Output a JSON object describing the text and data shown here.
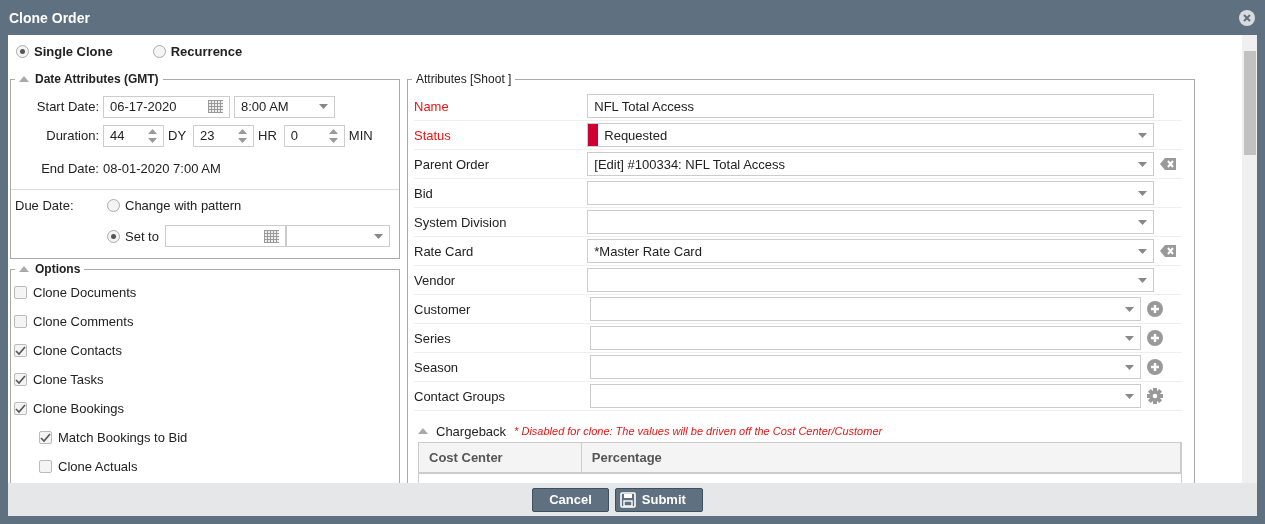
{
  "window": {
    "title": "Clone Order"
  },
  "mode_options": [
    {
      "label": "Single Clone",
      "selected": true
    },
    {
      "label": "Recurrence",
      "selected": false
    }
  ],
  "date_attributes": {
    "title": "Date Attributes (GMT)",
    "expanded": true,
    "start_date_label": "Start Date:",
    "start_date": "06-17-2020",
    "start_time": "8:00 AM",
    "duration_label": "Duration:",
    "duration": [
      {
        "value": "44",
        "unit": "DY"
      },
      {
        "value": "23",
        "unit": "HR"
      },
      {
        "value": "0",
        "unit": "MIN"
      }
    ],
    "end_date_label": "End Date:",
    "end_date": "08-01-2020 7:00 AM",
    "due_date_label": "Due Date:",
    "due_options": [
      {
        "label": "Change with pattern",
        "selected": false
      },
      {
        "label": "Set to",
        "selected": true
      }
    ]
  },
  "options": {
    "title": "Options",
    "expanded": true,
    "items": [
      {
        "label": "Clone Documents",
        "checked": false
      },
      {
        "label": "Clone Comments",
        "checked": false
      },
      {
        "label": "Clone Contacts",
        "checked": true
      },
      {
        "label": "Clone Tasks",
        "checked": true
      },
      {
        "label": "Clone Bookings",
        "checked": true,
        "children": [
          {
            "label": "Match Bookings to Bid",
            "checked": true
          },
          {
            "label": "Clone Actuals",
            "checked": false
          }
        ]
      }
    ]
  },
  "attributes": {
    "title": "Attributes [Shoot ]",
    "fields": [
      {
        "label": "Name",
        "required": true,
        "kind": "text",
        "value": "NFL Total Access"
      },
      {
        "label": "Status",
        "required": true,
        "kind": "select",
        "value": "Requested",
        "color": "#cc0033"
      },
      {
        "label": "Parent Order",
        "required": false,
        "kind": "select",
        "value": "[Edit] #100334: NFL Total Access",
        "clearable": true
      },
      {
        "label": "Bid",
        "required": false,
        "kind": "select"
      },
      {
        "label": "System Division",
        "required": false,
        "kind": "select"
      },
      {
        "label": "Rate Card",
        "required": false,
        "kind": "select",
        "value": "*Master Rate Card",
        "clearable": true
      },
      {
        "label": "Vendor",
        "required": false,
        "kind": "select"
      },
      {
        "label": "Customer",
        "required": false,
        "kind": "select",
        "add_button": true
      },
      {
        "label": "Series",
        "required": false,
        "kind": "select",
        "add_button": true
      },
      {
        "label": "Season",
        "required": false,
        "kind": "select",
        "add_button": true
      },
      {
        "label": "Contact Groups",
        "required": false,
        "kind": "select",
        "settings_button": true
      }
    ]
  },
  "chargeback": {
    "title": "Chargeback",
    "expanded": true,
    "note": "* Disabled for clone: The values will be driven off the Cost Center/Customer",
    "columns": [
      "Cost Center",
      "Percentage"
    ]
  },
  "buttons": [
    {
      "label": "Cancel",
      "kind": "plain"
    },
    {
      "label": "Submit",
      "kind": "save"
    }
  ]
}
